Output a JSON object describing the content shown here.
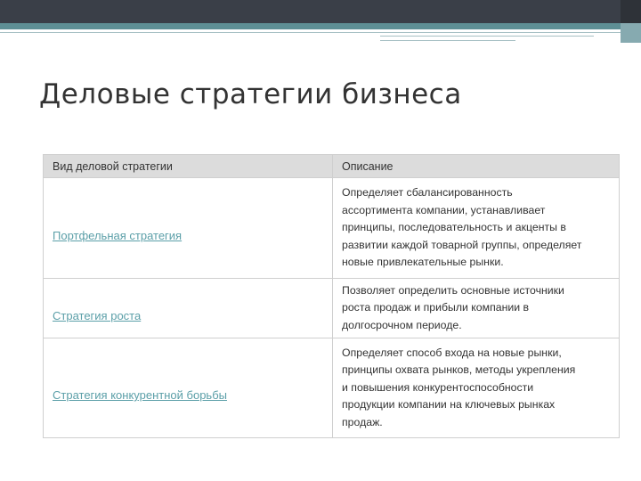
{
  "slide": {
    "title": "Деловые стратегии бизнеса"
  },
  "table": {
    "headers": [
      "Вид деловой стратегии",
      "Описание"
    ],
    "rows": [
      {
        "name": "Портфельная стратегия",
        "description_lines": [
          "Определяет сбалансированность",
          "ассортимента компании, устанавливает",
          "принципы, последовательность и акценты в",
          "развитии каждой товарной группы, определяет",
          "новые привлекательные рынки."
        ]
      },
      {
        "name": "Стратегия роста",
        "description_lines": [
          "Позволяет определить основные источники",
          "роста продаж и прибыли компании в",
          "долгосрочном периоде."
        ]
      },
      {
        "name": "Стратегия конкурентной борьбы",
        "description_lines": [
          "Определяет способ входа на новые рынки,",
          "принципы охвата рынков, методы укрепления",
          "и повышения конкурентоспособности",
          "продукции компании на ключевых рынках",
          "продаж."
        ]
      }
    ]
  },
  "colors": {
    "top_bar": "#3a3f48",
    "accent_teal": "#5e8f95",
    "link": "#5b9fa8",
    "header_fill": "#dcdcdc"
  }
}
